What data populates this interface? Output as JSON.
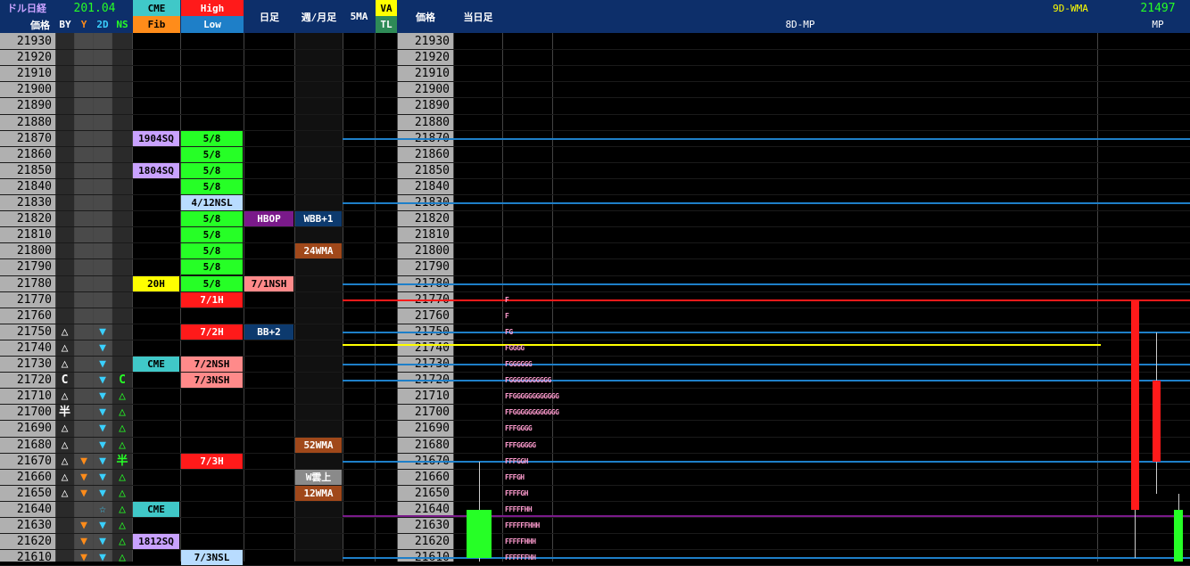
{
  "header": {
    "title": "ドル日経",
    "price_label": "価格",
    "flags": [
      "BY",
      "Y",
      "2D",
      "NS"
    ],
    "value": "201.04",
    "cme": "CME",
    "fib": "Fib",
    "high": "High",
    "low": "Low",
    "daily": "日足",
    "weekly": "週/月足",
    "ma5": "5MA",
    "va": "VA",
    "tl": "TL",
    "price2": "価格",
    "today": "当日足",
    "mp8": "8D-MP",
    "wma9": "9D-WMA",
    "mp_value": "21497",
    "mp": "MP"
  },
  "colors": {
    "header_bg": "#0d2f6a",
    "green": "#26ff26",
    "red": "#ff1a1a",
    "salmon": "#ff8a8a",
    "lavender": "#c9a2ff",
    "cyan": "#40c8c8",
    "lightblue": "#b8dcff",
    "yellow": "#ffff00",
    "purple": "#7a1a8a",
    "navy": "#0d3a6e",
    "brown": "#a0481a",
    "blue_line": "#1e7fc8"
  },
  "chart_data": {
    "type": "table",
    "prices": [
      21930,
      21920,
      21910,
      21900,
      21890,
      21880,
      21870,
      21860,
      21850,
      21840,
      21830,
      21820,
      21810,
      21800,
      21790,
      21780,
      21770,
      21760,
      21750,
      21740,
      21730,
      21720,
      21710,
      21700,
      21690,
      21680,
      21670,
      21660,
      21650,
      21640,
      21630,
      21620,
      21610
    ],
    "by_col": {
      "21750": "△",
      "21740": "△",
      "21730": "△",
      "21720": "C",
      "21710": "△",
      "21700": "半",
      "21690": "△",
      "21680": "△",
      "21670": "△",
      "21660": "△",
      "21650": "△"
    },
    "y_col": [
      "21670",
      "21660",
      "21650",
      "21630",
      "21620",
      "21610"
    ],
    "d2_col": {
      "21750": "▼",
      "21740": "▼",
      "21730": "▼",
      "21720": "▼",
      "21710": "▼",
      "21700": "▼",
      "21690": "▼",
      "21680": "▼",
      "21670": "▼",
      "21660": "▼",
      "21650": "▼",
      "21640": "☆",
      "21630": "▼",
      "21620": "▼",
      "21610": "▼"
    },
    "ns_col": {
      "21720": "C",
      "21710": "△",
      "21700": "△",
      "21690": "△",
      "21680": "△",
      "21670": "半",
      "21660": "△",
      "21650": "△",
      "21640": "△",
      "21630": "△",
      "21620": "△",
      "21610": "△"
    },
    "cme_col": [
      {
        "price": "21870",
        "text": "1904SQ",
        "color": "lavender"
      },
      {
        "price": "21850",
        "text": "1804SQ",
        "color": "lavender"
      },
      {
        "price": "21780",
        "text": "20H",
        "color": "yellow"
      },
      {
        "price": "21730",
        "text": "CME",
        "color": "cyan"
      },
      {
        "price": "21640",
        "text": "CME",
        "color": "cyan"
      },
      {
        "price": "21620",
        "text": "1812SQ",
        "color": "lavender"
      }
    ],
    "hl_col": [
      {
        "price": "21870",
        "text": "5/8",
        "color": "green"
      },
      {
        "price": "21860",
        "text": "5/8",
        "color": "green"
      },
      {
        "price": "21850",
        "text": "5/8",
        "color": "green"
      },
      {
        "price": "21840",
        "text": "5/8",
        "color": "green"
      },
      {
        "price": "21830",
        "text": "4/12NSL",
        "color": "lightblue"
      },
      {
        "price": "21820",
        "text": "5/8",
        "color": "green"
      },
      {
        "price": "21810",
        "text": "5/8",
        "color": "green"
      },
      {
        "price": "21800",
        "text": "5/8",
        "color": "green"
      },
      {
        "price": "21790",
        "text": "5/8",
        "color": "green"
      },
      {
        "price": "21780",
        "text": "5/8",
        "color": "green"
      },
      {
        "price": "21770",
        "text": "7/1H",
        "color": "red"
      },
      {
        "price": "21750",
        "text": "7/2H",
        "color": "red"
      },
      {
        "price": "21730",
        "text": "7/2NSH",
        "color": "salmon"
      },
      {
        "price": "21720",
        "text": "7/3NSH",
        "color": "salmon"
      },
      {
        "price": "21670",
        "text": "7/3H",
        "color": "red"
      },
      {
        "price": "21610",
        "text": "7/3NSL",
        "color": "lightblue"
      }
    ],
    "daily_col": [
      {
        "price": "21820",
        "text": "HBOP",
        "color": "purple"
      },
      {
        "price": "21780",
        "text": "7/1NSH",
        "color": "salmon"
      },
      {
        "price": "21750",
        "text": "BB+2",
        "color": "navy"
      }
    ],
    "weekly_col": [
      {
        "price": "21820",
        "text": "WBB+1",
        "color": "navy"
      },
      {
        "price": "21800",
        "text": "24WMA",
        "color": "brown"
      },
      {
        "price": "21680",
        "text": "52WMA",
        "color": "brown"
      },
      {
        "price": "21660",
        "text": "W雲上",
        "color": "gray"
      },
      {
        "price": "21650",
        "text": "12WMA",
        "color": "brown"
      }
    ],
    "tpo": [
      {
        "price": "21770",
        "text": "F"
      },
      {
        "price": "21760",
        "text": "F"
      },
      {
        "price": "21750",
        "text": "FG"
      },
      {
        "price": "21740",
        "text": "FGGGG"
      },
      {
        "price": "21730",
        "text": "FGGGGGG"
      },
      {
        "price": "21720",
        "text": "FGGGGGGGGGGG"
      },
      {
        "price": "21710",
        "text": "FFGGGGGGGGGGGG"
      },
      {
        "price": "21700",
        "text": "FFGGGGGGGGGGGG"
      },
      {
        "price": "21690",
        "text": "FFFGGGG"
      },
      {
        "price": "21680",
        "text": "FFFGGGGG"
      },
      {
        "price": "21670",
        "text": "FFFGGH"
      },
      {
        "price": "21660",
        "text": "FFFGH"
      },
      {
        "price": "21650",
        "text": "FFFFGH"
      },
      {
        "price": "21640",
        "text": "FFFFFHH"
      },
      {
        "price": "21630",
        "text": "FFFFFFHHH"
      },
      {
        "price": "21620",
        "text": "FFFFFHHH"
      },
      {
        "price": "21610",
        "text": "FFFFFFHH"
      }
    ],
    "hlines": [
      {
        "price": "21870",
        "color": "blue_line"
      },
      {
        "price": "21830",
        "color": "blue_line"
      },
      {
        "price": "21780",
        "color": "blue_line"
      },
      {
        "price": "21770",
        "color": "red"
      },
      {
        "price": "21750",
        "color": "blue_line"
      },
      {
        "price": "21742",
        "color": "yellow"
      },
      {
        "price": "21730",
        "color": "blue_line"
      },
      {
        "price": "21720",
        "color": "blue_line"
      },
      {
        "price": "21670",
        "color": "blue_line"
      },
      {
        "price": "21636",
        "color": "purple"
      },
      {
        "price": "21610",
        "color": "blue_line"
      }
    ],
    "candles": [
      {
        "name": "today",
        "open": 21610,
        "close": 21640,
        "high": 21670,
        "low": 21600,
        "color": "green"
      },
      {
        "name": "mp-red-1",
        "open": 21770,
        "close": 21640,
        "high": 21770,
        "low": 21610,
        "color": "red"
      },
      {
        "name": "mp-red-2",
        "open": 21720,
        "close": 21670,
        "high": 21750,
        "low": 21650,
        "color": "red"
      },
      {
        "name": "mp-green",
        "open": 21640,
        "close": 21600,
        "high": 21650,
        "low": 21600,
        "color": "green"
      }
    ]
  }
}
